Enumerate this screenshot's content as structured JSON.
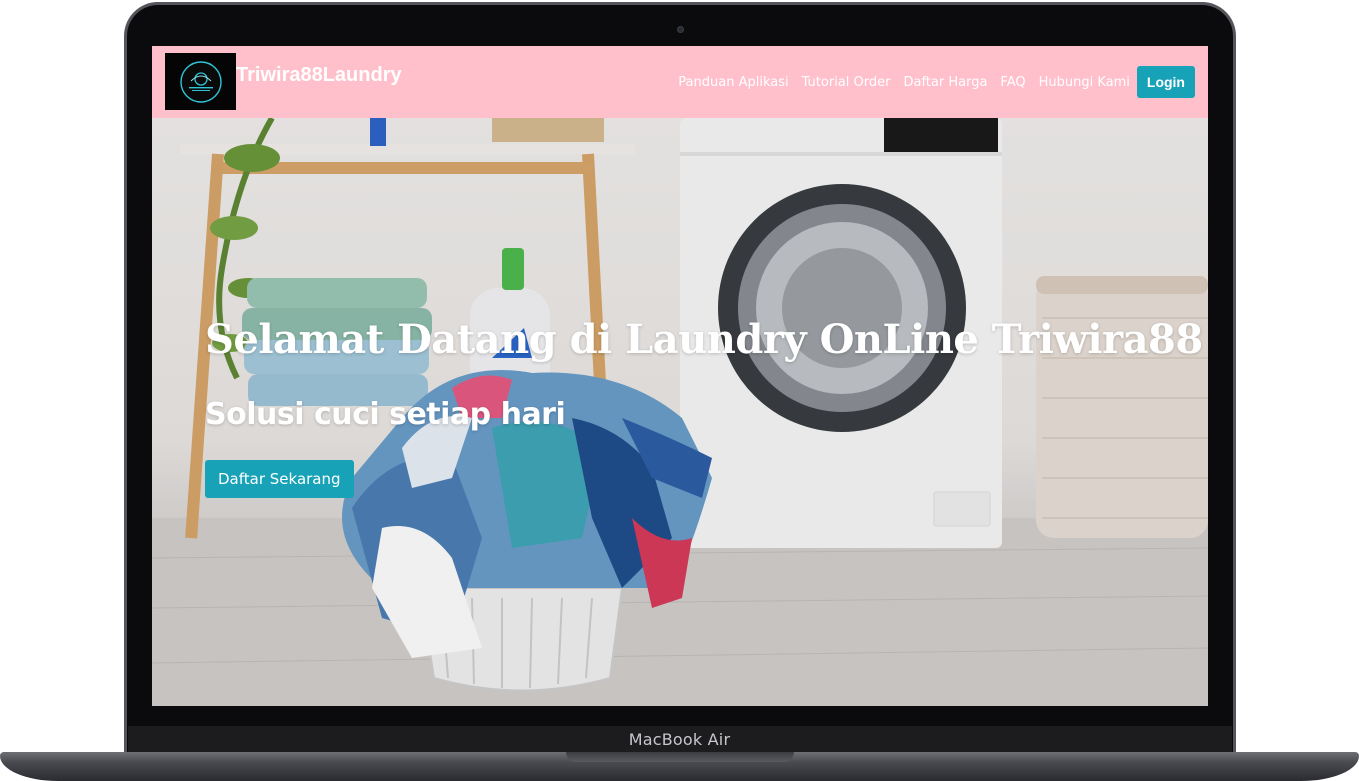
{
  "device": {
    "label": "MacBook Air"
  },
  "navbar": {
    "brand": "Triwira88Laundry",
    "links": [
      "Panduan Aplikasi",
      "Tutorial Order",
      "Daftar Harga",
      "FAQ",
      "Hubungi Kami"
    ],
    "login_label": "Login",
    "background_color": "#ffc0cb"
  },
  "hero": {
    "title": "Selamat Datang di Laundry OnLine Triwira88",
    "subtitle": "Solusi cuci setiap hari",
    "cta_label": "Daftar Sekarang",
    "accent_color": "#17a2b8",
    "image_icon": "laundry-room-image"
  }
}
